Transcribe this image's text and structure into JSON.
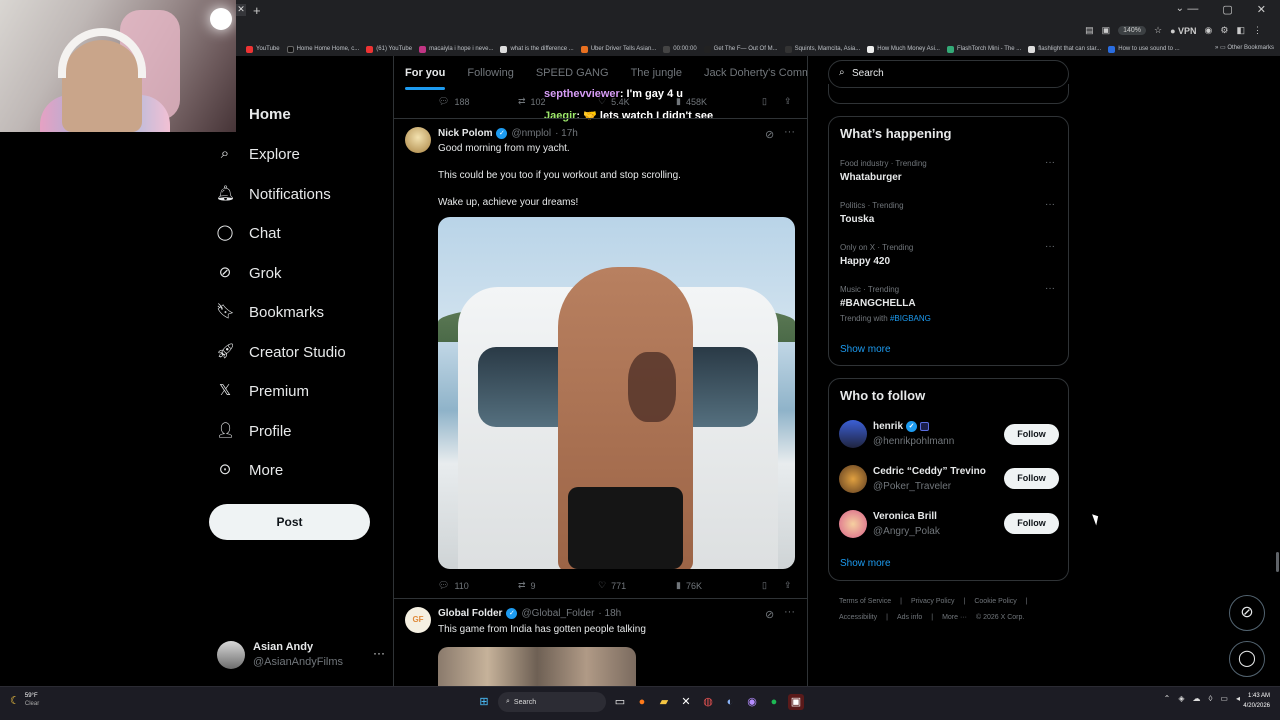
{
  "browser": {
    "zoom": "140%",
    "vpn": "VPN",
    "bookmarks": [
      "YouTube",
      "Home Home Home, c...",
      "(61) YouTube",
      "macaiyla i hope i neve...",
      "what is the difference ...",
      "Uber Driver Tells Asian...",
      "00:00:00",
      "Get The F— Out Of M...",
      "Squints, Mamcita, Asia...",
      "How Much Money Asi...",
      "FlashTorch Mini - The ...",
      "flashlight that can star...",
      "How to use sound to ..."
    ],
    "other_bookmarks": "Other Bookmarks"
  },
  "nav": {
    "home": "Home",
    "items": [
      {
        "label": "Explore",
        "icon": "search-icon"
      },
      {
        "label": "Notifications",
        "icon": "bell-icon"
      },
      {
        "label": "Chat",
        "icon": "chat-bubble-icon"
      },
      {
        "label": "Grok",
        "icon": "grok-icon"
      },
      {
        "label": "Bookmarks",
        "icon": "bookmark-icon"
      },
      {
        "label": "Creator Studio",
        "icon": "rocket-icon"
      },
      {
        "label": "Premium",
        "icon": "x-logo-icon"
      },
      {
        "label": "Profile",
        "icon": "person-icon"
      },
      {
        "label": "More",
        "icon": "more-circle-icon"
      }
    ],
    "post_label": "Post",
    "account": {
      "name": "Asian Andy",
      "handle": "@AsianAndyFilms",
      "more": "···"
    }
  },
  "feed": {
    "tabs": [
      "For you",
      "Following",
      "SPEED GANG",
      "The jungle",
      "Jack Doherty's Commur"
    ],
    "prev_actions": {
      "replies": "188",
      "reposts": "102",
      "likes": "5.4K",
      "views": "458K"
    },
    "chat_overlay": [
      {
        "user": "septhevviewer",
        "text": ": I'm gay 4 u",
        "color": "#d69cf5"
      },
      {
        "user": "Jaegir",
        "text": ": 🤝 lets watch I didn't see",
        "color": "#9ee86b"
      }
    ],
    "tweet1": {
      "name": "Nick Polom",
      "handle": "@nmplol",
      "time": "· 17h",
      "lines": [
        "Good morning from my yacht.",
        "This could be you too if you workout and stop scrolling.",
        "Wake up, achieve your dreams!"
      ],
      "replies": "110",
      "reposts": "9",
      "likes": "771",
      "views": "76K"
    },
    "tweet2": {
      "name": "Global Folder",
      "handle": "@Global_Folder",
      "time": "· 18h",
      "text": "This game from India has gotten people talking"
    }
  },
  "sidebar": {
    "search_placeholder": "Search",
    "happening_title": "What’s happening",
    "trends": [
      {
        "meta": "Food industry · Trending",
        "name": "Whataburger"
      },
      {
        "meta": "Politics · Trending",
        "name": "Touska"
      },
      {
        "meta": "Only on X · Trending",
        "name": "Happy 420"
      },
      {
        "meta": "Music · Trending",
        "name": "#BANGCHELLA",
        "with_label": "Trending with",
        "with_tag": "#BIGBANG"
      }
    ],
    "show_more": "Show more",
    "wtf_title": "Who to follow",
    "follow_label": "Follow",
    "people": [
      {
        "name": "henrik",
        "handle": "@henrikpohlmann"
      },
      {
        "name": "Cedric “Ceddy” Trevino",
        "handle": "@Poker_Traveler"
      },
      {
        "name": "Veronica Brill",
        "handle": "@Angry_Polak"
      }
    ],
    "footer": [
      "Terms of Service",
      "|",
      "Privacy Policy",
      "|",
      "Cookie Policy",
      "|",
      "Accessibility",
      "|",
      "Ads info",
      "|",
      "More ···",
      "© 2026 X Corp."
    ]
  },
  "taskbar": {
    "temp": "59°F",
    "condition": "Clear",
    "search": "Search",
    "time": "1:43 AM",
    "date": "4/20/2026"
  }
}
